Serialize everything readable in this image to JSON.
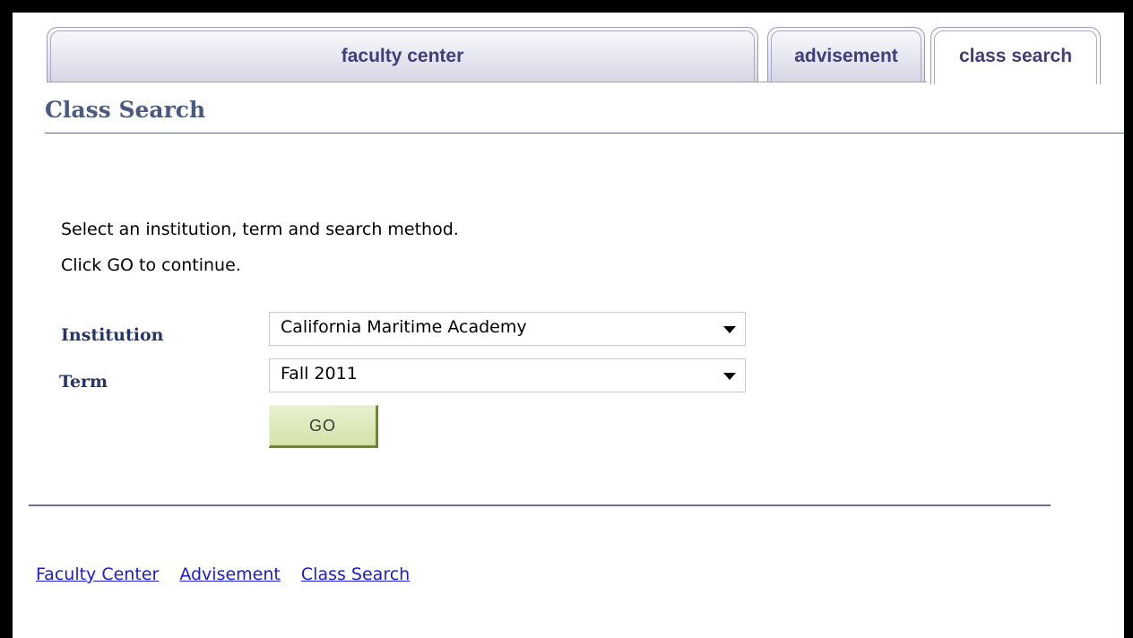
{
  "tabs": [
    {
      "label": "faculty center",
      "active": false
    },
    {
      "label": "advisement",
      "active": false
    },
    {
      "label": "class search",
      "active": true
    }
  ],
  "page_title": "Class Search",
  "instructions": {
    "line1": "Select an institution, term and search method.",
    "line2": "Click GO to continue."
  },
  "form": {
    "institution_label": "Institution",
    "institution_value": "California Maritime Academy",
    "term_label": "Term",
    "term_value": "Fall 2011",
    "go_label": "GO"
  },
  "footer_links": [
    "Faculty Center",
    "Advisement",
    "Class Search"
  ],
  "colors": {
    "tab_text": "#3f3d7a",
    "title": "#4b5a82",
    "label": "#26346a",
    "go_button": "#d4e2a8",
    "link": "#1a1ad8"
  }
}
